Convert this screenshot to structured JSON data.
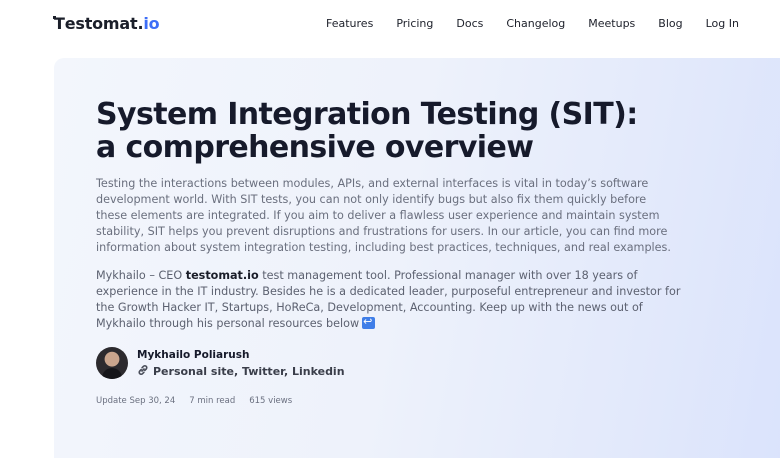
{
  "nav": {
    "logo_main": "Testomat.",
    "logo_accent": "io",
    "links": [
      "Features",
      "Pricing",
      "Docs",
      "Changelog",
      "Meetups",
      "Blog",
      "Log In"
    ]
  },
  "article": {
    "title_line1": "System Integration Testing (SIT):",
    "title_line2": "a comprehensive overview",
    "intro": "Testing the interactions between modules, APIs, and external interfaces is vital in today’s software development world. With SIT tests, you can not only identify bugs but also fix them quickly before these elements are integrated. If you aim to deliver a flawless user experience and maintain system stability, SIT helps you prevent disruptions and frustrations for users. In our article, you can find more information about system integration testing, including best practices, techniques, and real examples.",
    "bio_prefix": "Mykhailo – CEO ",
    "bio_brand": "testomat.io",
    "bio_suffix": " test management tool. Professional manager with over 18 years of experience in the IT industry. Besides he is a dedicated leader, purposeful entrepreneur and investor for the Growth Hacker IT, Startups, HoReCa, Development, Accounting. Keep up with the news out of Mykhailo through his personal resources below"
  },
  "author": {
    "name": "Mykhailo Poliarush",
    "links_text": "Personal site, Twitter, Linkedin"
  },
  "meta": {
    "updated": "Update Sep 30, 24",
    "read_time": "7 min read",
    "views": "615 views"
  },
  "icons": {
    "link": "link-icon",
    "arrow": "return-arrow-icon"
  },
  "colors": {
    "accent": "#3d6ef7",
    "title": "#161a2b",
    "body_text": "#6a6f7e"
  }
}
